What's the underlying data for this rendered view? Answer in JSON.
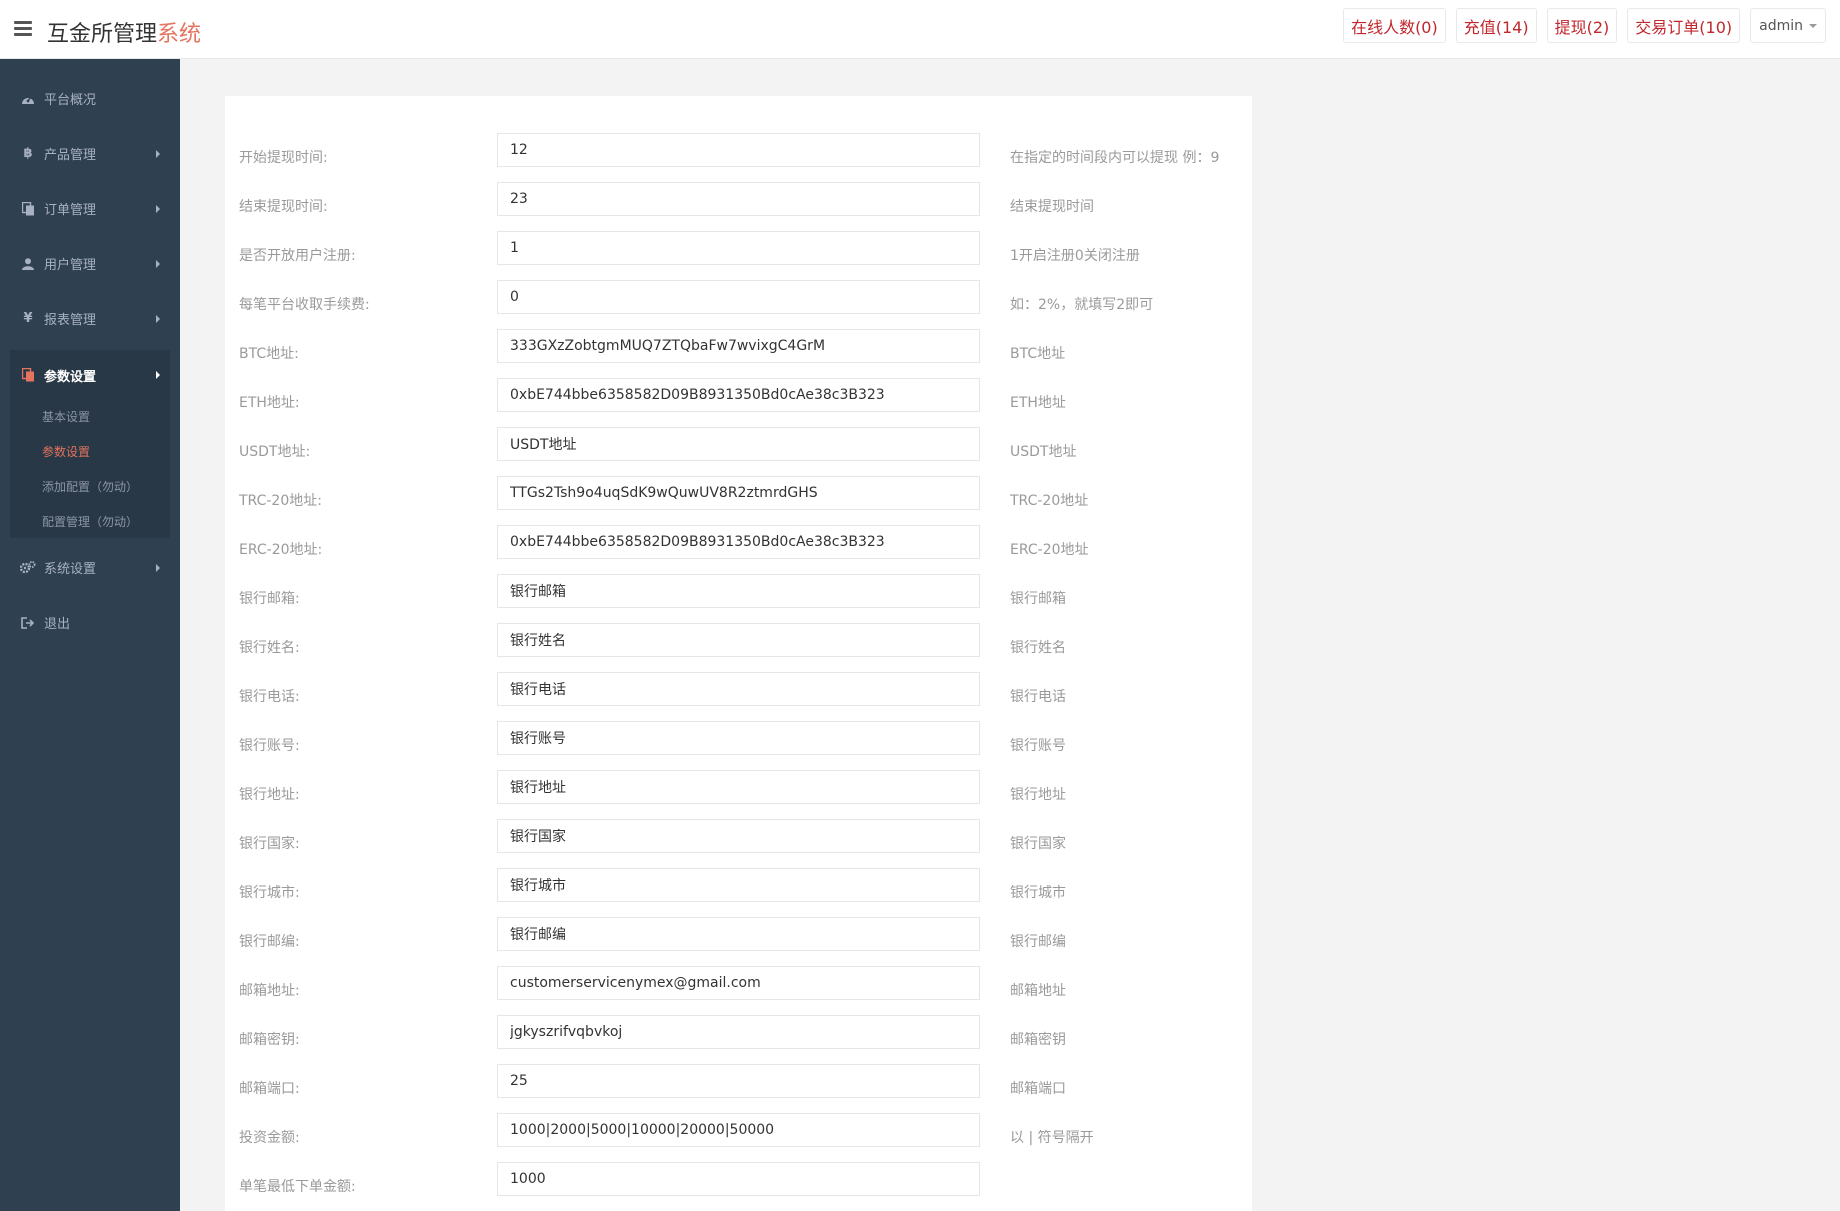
{
  "header": {
    "brand_main": "互金所管理",
    "brand_accent": "系统",
    "online": "在线人数(0)",
    "recharge": "充值(14)",
    "withdraw": "提现(2)",
    "orders": "交易订单(10)",
    "user": "admin"
  },
  "sidebar": {
    "items": [
      {
        "label": "平台概况"
      },
      {
        "label": "产品管理"
      },
      {
        "label": "订单管理"
      },
      {
        "label": "用户管理"
      },
      {
        "label": "报表管理"
      },
      {
        "label": "参数设置"
      },
      {
        "label": "系统设置"
      },
      {
        "label": "退出"
      }
    ],
    "sub": [
      {
        "label": "基本设置"
      },
      {
        "label": "参数设置"
      },
      {
        "label": "添加配置（勿动）"
      },
      {
        "label": "配置管理（勿动）"
      }
    ]
  },
  "form": {
    "rows": [
      {
        "label": "开始提现时间:",
        "value": "12",
        "hint": "在指定的时间段内可以提现 例：9"
      },
      {
        "label": "结束提现时间:",
        "value": "23",
        "hint": "结束提现时间"
      },
      {
        "label": "是否开放用户注册:",
        "value": "1",
        "hint": "1开启注册0关闭注册"
      },
      {
        "label": "每笔平台收取手续费:",
        "value": "0",
        "hint": "如：2%，就填写2即可"
      },
      {
        "label": "BTC地址:",
        "value": "333GXzZobtgmMUQ7ZTQbaFw7wvixgC4GrM",
        "hint": "BTC地址"
      },
      {
        "label": "ETH地址:",
        "value": "0xbE744bbe6358582D09B8931350Bd0cAe38c3B323",
        "hint": "ETH地址"
      },
      {
        "label": "USDT地址:",
        "value": "USDT地址",
        "hint": "USDT地址"
      },
      {
        "label": "TRC-20地址:",
        "value": "TTGs2Tsh9o4uqSdK9wQuwUV8R2ztmrdGHS",
        "hint": "TRC-20地址"
      },
      {
        "label": "ERC-20地址:",
        "value": "0xbE744bbe6358582D09B8931350Bd0cAe38c3B323",
        "hint": "ERC-20地址"
      },
      {
        "label": "银行邮箱:",
        "value": "银行邮箱",
        "hint": "银行邮箱"
      },
      {
        "label": "银行姓名:",
        "value": "银行姓名",
        "hint": "银行姓名"
      },
      {
        "label": "银行电话:",
        "value": "银行电话",
        "hint": "银行电话"
      },
      {
        "label": "银行账号:",
        "value": "银行账号",
        "hint": "银行账号"
      },
      {
        "label": "银行地址:",
        "value": "银行地址",
        "hint": "银行地址"
      },
      {
        "label": "银行国家:",
        "value": "银行国家",
        "hint": "银行国家"
      },
      {
        "label": "银行城市:",
        "value": "银行城市",
        "hint": "银行城市"
      },
      {
        "label": "银行邮编:",
        "value": "银行邮编",
        "hint": "银行邮编"
      },
      {
        "label": "邮箱地址:",
        "value": "customerservicenymex@gmail.com",
        "hint": "邮箱地址"
      },
      {
        "label": "邮箱密钥:",
        "value": "jgkyszrifvqbvkoj",
        "hint": "邮箱密钥"
      },
      {
        "label": "邮箱端口:",
        "value": "25",
        "hint": "邮箱端口"
      },
      {
        "label": "投资金额:",
        "value": "1000|2000|5000|10000|20000|50000",
        "hint": "以 | 符号隔开"
      },
      {
        "label": "单笔最低下单金额:",
        "value": "1000",
        "hint": ""
      }
    ]
  }
}
